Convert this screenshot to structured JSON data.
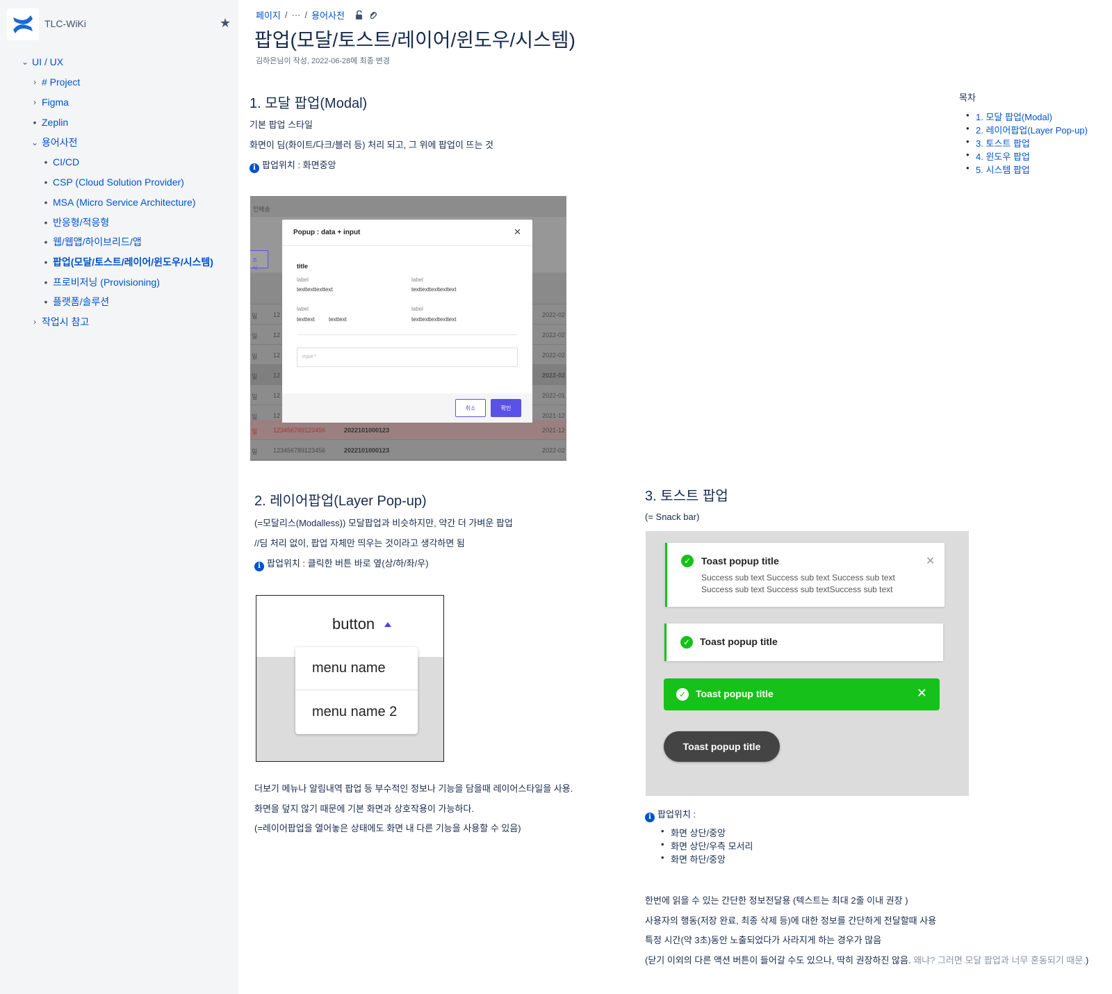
{
  "sidebar": {
    "space_name": "TLC-WiKi",
    "items": [
      {
        "label": "UI / UX"
      },
      {
        "label": "# Project"
      },
      {
        "label": "Figma"
      },
      {
        "label": "Zeplin"
      },
      {
        "label": "용어사전"
      },
      {
        "label": "CI/CD"
      },
      {
        "label": "CSP (Cloud Solution Provider)"
      },
      {
        "label": "MSA (Micro Service Architecture)"
      },
      {
        "label": "반응형/적응형"
      },
      {
        "label": "웹/웹앱/하이브리드/앱"
      },
      {
        "label": "팝업(모달/토스트/레이어/윈도우/시스템)"
      },
      {
        "label": "프로비저닝 (Provisioning)"
      },
      {
        "label": "플랫폼/솔루션"
      },
      {
        "label": "작업시 참고"
      }
    ]
  },
  "breadcrumb": {
    "root": "페이지",
    "sep1": "/",
    "ellipsis": "···",
    "sep2": "/",
    "parent": "용어사전"
  },
  "page": {
    "title": "팝업(모달/토스트/레이어/윈도우/시스템)",
    "byline": "김하은님이 작성, 2022-06-28에 최종 변경"
  },
  "toc": {
    "title": "목차",
    "items": [
      "1. 모달 팝업(Modal)",
      "2. 레이어팝업(Layer Pop-up)",
      "3. 토스트 팝업",
      "4. 윈도우 팝업",
      "5. 시스템 팝업"
    ]
  },
  "section1": {
    "heading": "1. 모달 팝업(Modal)",
    "line1": "기본 팝업 스타일",
    "line2": "화면이 딤(화이트/다크/블러 등) 처리 되고, 그 위에 팝업이 뜨는 것",
    "position": "팝업위치 : 화면중앙",
    "image": {
      "bg_header": "인배송",
      "bg_button": "조시",
      "bg_rows": [
        {
          "c1": "일",
          "c2": "12",
          "date": "2022-02"
        },
        {
          "c1": "일",
          "c2": "12",
          "date": "2022-02"
        },
        {
          "c1": "일",
          "c2": "12",
          "date": "2022-02"
        },
        {
          "c1": "일",
          "c2": "12",
          "date": "2022-02"
        },
        {
          "c1": "일",
          "c2": "12",
          "date": "2022-01"
        },
        {
          "c1": "일",
          "c2": "12",
          "date": "2021-12"
        },
        {
          "c1": "일",
          "c2": "123456789123456",
          "c3": "2022101000123",
          "date": "2021-12"
        },
        {
          "c1": "일",
          "c2": "123456789123456",
          "c3": "2022101000123",
          "date": "2022-02"
        }
      ],
      "modal_title": "Popup : data + input",
      "title": "title",
      "label": "label",
      "v1": "texttexttexttext",
      "v2": "texttexttexttexttext",
      "v3a": "texttext",
      "v3b": "texttext",
      "v4": "texttexttexttexttext",
      "input_placeholder": "input *",
      "cancel": "취소",
      "ok": "확인"
    }
  },
  "section2": {
    "heading": "2. 레이어팝업(Layer Pop-up)",
    "line1": "(=모달리스(Modalless)) 모달팝업과 비슷하지만, 약간 더 가벼운 팝업",
    "line2": "//딤 처리 없이, 팝업 자체만 띄우는 것이라고 생각하면 됨",
    "position": "팝업위치 : 클릭한 버튼 바로 옆(상/하/좌/우)",
    "image": {
      "button": "button",
      "menu1": "menu name",
      "menu2": "menu name 2"
    },
    "desc1": "더보기 메뉴나 알림내역 팝업 등 부수적인 정보나 기능을 담을때 레이어스타일을 사용.",
    "desc2": "화면을 덮지 않기 때문에 기본 화면과 상호작용이 가능하다.",
    "desc3": "(=레이어팝업을 열어놓은 상태에도 화면 내 다른 기능을 사용할 수 있음)"
  },
  "section3": {
    "heading": "3. 토스트 팝업",
    "sub": "(= Snack bar)",
    "image": {
      "toast_title": "Toast popup title",
      "sub1": "Success sub text Success sub text Success sub text",
      "sub2": "Success sub text Success sub textSuccess sub text"
    },
    "position": "팝업위치 :",
    "positions": [
      "화면 상단/중앙",
      "화면 상단/우측 모서리",
      "화면 하단/중앙"
    ],
    "desc1": "한번에 읽을 수 있는 간단한 정보전달용 (텍스트는 최대 2줄 이내 권장 )",
    "desc2": "사용자의 행동(저장 완료, 최종 삭제 등)에 대한 정보를 간단하게 전달할때 사용",
    "desc3": "특정 시간(약 3초)동안 노출되었다가 사라지게 하는 경우가 많음",
    "desc4a": "(닫기 이외의 다른 액션 버튼이 들어갈 수도 있으나, 딱히 권장하진 않음.",
    "desc4b": "왜냐? 그러면 모달 팝업과 너무 혼동되기 때문.",
    "desc4c": ")"
  }
}
